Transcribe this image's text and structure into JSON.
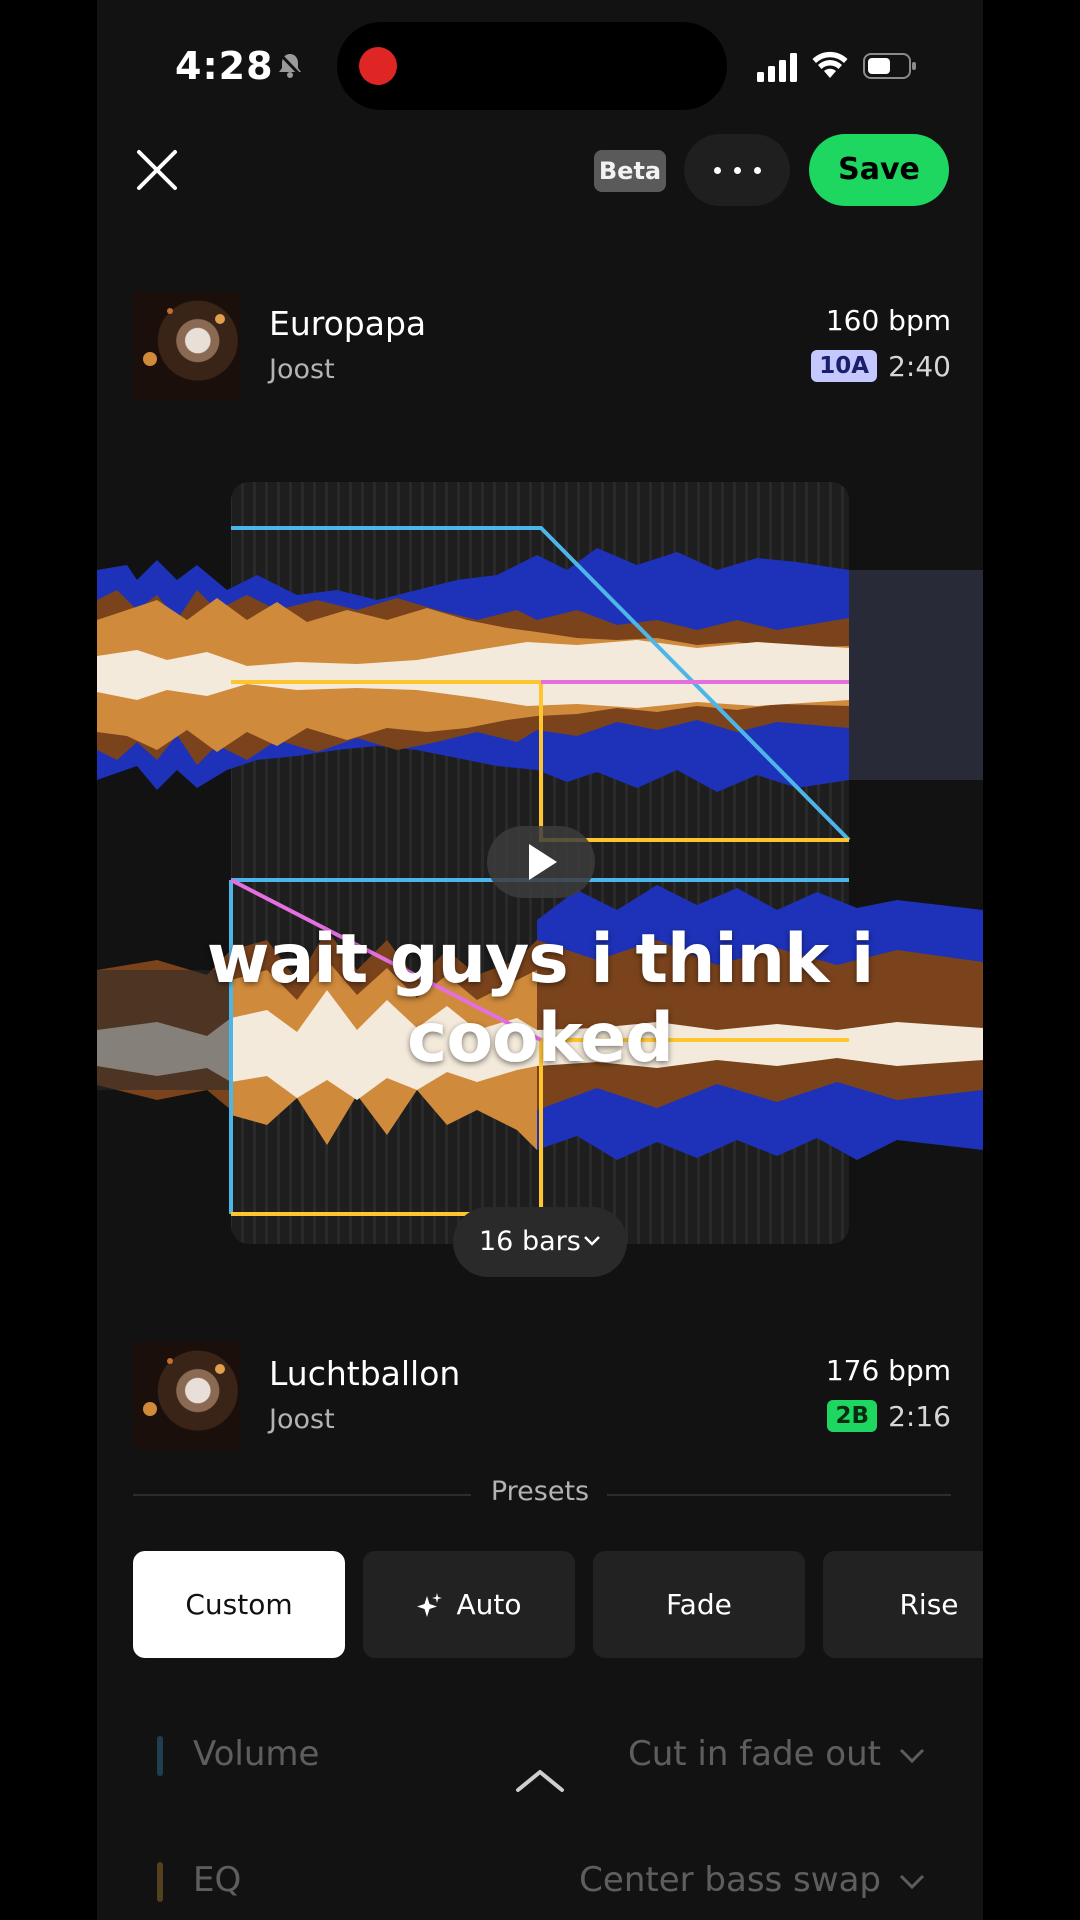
{
  "status_bar": {
    "time": "4:28"
  },
  "header": {
    "beta_label": "Beta",
    "save_label": "Save"
  },
  "track_a": {
    "title": "Europapa",
    "artist": "Joost",
    "bpm": "160 bpm",
    "key": "10A",
    "key_color": "#c4c8ff",
    "duration": "2:40"
  },
  "track_b": {
    "title": "Luchtballon",
    "artist": "Joost",
    "bpm": "176 bpm",
    "key": "2B",
    "key_color": "#1ed760",
    "duration": "2:16"
  },
  "caption": "wait guys i think i cooked",
  "transition": {
    "length_label": "16 bars"
  },
  "presets": {
    "label": "Presets",
    "items": [
      {
        "label": "Custom",
        "active": true
      },
      {
        "label": "Auto",
        "icon": "sparkle-icon"
      },
      {
        "label": "Fade"
      },
      {
        "label": "Rise"
      }
    ]
  },
  "params": [
    {
      "name": "Volume",
      "value": "Cut in fade out",
      "color": "#3a9bd8"
    },
    {
      "name": "EQ",
      "value": "Center bass swap",
      "color": "#d8a23a"
    }
  ],
  "colors": {
    "accent": "#1ed760",
    "volume_line": "#4db6e8",
    "bass_line": "#ffc52e",
    "mid_line": "#e46fe0"
  }
}
